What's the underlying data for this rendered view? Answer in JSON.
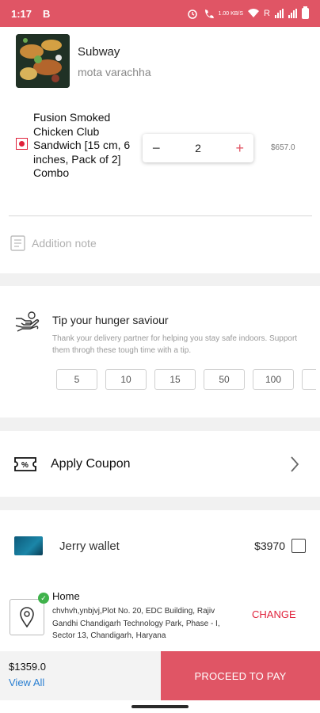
{
  "status_bar": {
    "time": "1:17",
    "b_icon": "B",
    "net_speed": "1.00 KB/S",
    "net_type": "R"
  },
  "restaurant": {
    "name": "Subway",
    "location": "mota varachha"
  },
  "cart_item": {
    "name": "Fusion Smoked Chicken Club Sandwich [15 cm, 6 inches, Pack of 2] Combo",
    "quantity": "2",
    "minus": "−",
    "plus": "+",
    "price": "$657.0"
  },
  "note": {
    "placeholder": "Addition note"
  },
  "tip": {
    "title": "Tip your hunger saviour",
    "description": "Thank your delivery partner for helping you stay safe indoors. Support them throgh these tough time with a tip.",
    "options": [
      "5",
      "10",
      "15",
      "50",
      "100"
    ]
  },
  "coupon": {
    "label": "Apply Coupon"
  },
  "wallet": {
    "name": "Jerry wallet",
    "amount": "$3970"
  },
  "address": {
    "title": "Home",
    "text": "chvhvh,ynbjvj,Plot No. 20, EDC Building, Rajiv Gandhi Chandigarh Technology Park, Phase - I, Sector 13, Chandigarh, Haryana",
    "change": "CHANGE"
  },
  "bottom": {
    "total": "$1359.0",
    "view_all": "View All",
    "proceed": "PROCEED TO PAY"
  },
  "colors": {
    "brand": "#e05565",
    "veg_mark": "#e0223b",
    "link": "#2a7fd1",
    "verified": "#3fb24b"
  }
}
